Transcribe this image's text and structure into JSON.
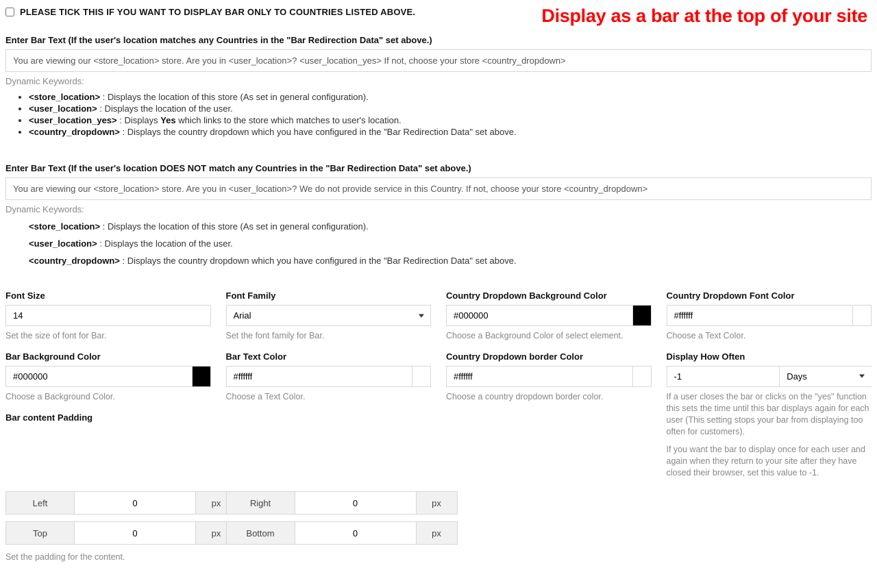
{
  "hero": "Display as a bar at the top of your site",
  "checkbox": {
    "label": "PLEASE TICK THIS IF YOU WANT TO DISPLAY BAR ONLY TO COUNTRIES LISTED ABOVE."
  },
  "match": {
    "label": "Enter Bar Text (If the user's location matches any Countries in the \"Bar Redirection Data\" set above.)",
    "value": "You are viewing our <store_location> store. Are you in <user_location>? <user_location_yes> If not, choose your store <country_dropdown>",
    "dyn_label": "Dynamic Keywords:",
    "kw": {
      "store_location": {
        "k": "<store_location>",
        "d": " : Displays the location of this store (As set in general configuration)."
      },
      "user_location": {
        "k": "<user_location>",
        "d": " : Displays the location of the user."
      },
      "user_location_yes": {
        "k": "<user_location_yes>",
        "d1": " : Displays ",
        "yes": "Yes",
        "d2": " which links to the store which matches to user's location."
      },
      "country_dropdown": {
        "k": "<country_dropdown>",
        "d": " : Displays the country dropdown which you have configured in the \"Bar Redirection Data\" set above."
      }
    }
  },
  "nomatch": {
    "label": "Enter Bar Text (If the user's location DOES NOT match any Countries in the \"Bar Redirection Data\" set above.)",
    "value": "You are viewing our <store_location> store. Are you in <user_location>? We do not provide service in this Country. If not, choose your store <country_dropdown>",
    "dyn_label": "Dynamic Keywords:",
    "kw": {
      "store_location": {
        "k": "<store_location>",
        "d": " : Displays the location of this store (As set in general configuration)."
      },
      "user_location": {
        "k": "<user_location>",
        "d": " : Displays the location of the user."
      },
      "country_dropdown": {
        "k": "<country_dropdown>",
        "d": " : Displays the country dropdown which you have configured in the \"Bar Redirection Data\" set above."
      }
    }
  },
  "fields": {
    "font_size": {
      "label": "Font Size",
      "value": "14",
      "help": "Set the size of font for Bar."
    },
    "font_family": {
      "label": "Font Family",
      "value": "Arial",
      "help": "Set the font family for Bar."
    },
    "dd_bg": {
      "label": "Country Dropdown Background Color",
      "value": "#000000",
      "help": "Choose a Background Color of select element."
    },
    "dd_font": {
      "label": "Country Dropdown Font Color",
      "value": "#ffffff",
      "help": "Choose a Text Color."
    },
    "bar_bg": {
      "label": "Bar Background Color",
      "value": "#000000",
      "help": "Choose a Background Color."
    },
    "bar_text": {
      "label": "Bar Text Color",
      "value": "#ffffff",
      "help": "Choose a Text Color."
    },
    "dd_border": {
      "label": "Country Dropdown border Color",
      "value": "#ffffff",
      "help": "Choose a country dropdown border color."
    },
    "how_often": {
      "label": "Display How Often",
      "value": "-1",
      "unit": "Days",
      "help1": "If a user closes the bar or clicks on the \"yes\" function this sets the time until this bar displays again for each user (This setting stops your bar from displaying too often for customers).",
      "help2": "If you want the bar to display once for each user and again when they return to your site after they have closed their browser, set this value to -1."
    }
  },
  "padding": {
    "label": "Bar content Padding",
    "help": "Set the padding for the content.",
    "unit": "px",
    "left": {
      "label": "Left",
      "value": "0"
    },
    "right": {
      "label": "Right",
      "value": "0"
    },
    "top": {
      "label": "Top",
      "value": "0"
    },
    "bottom": {
      "label": "Bottom",
      "value": "0"
    }
  }
}
